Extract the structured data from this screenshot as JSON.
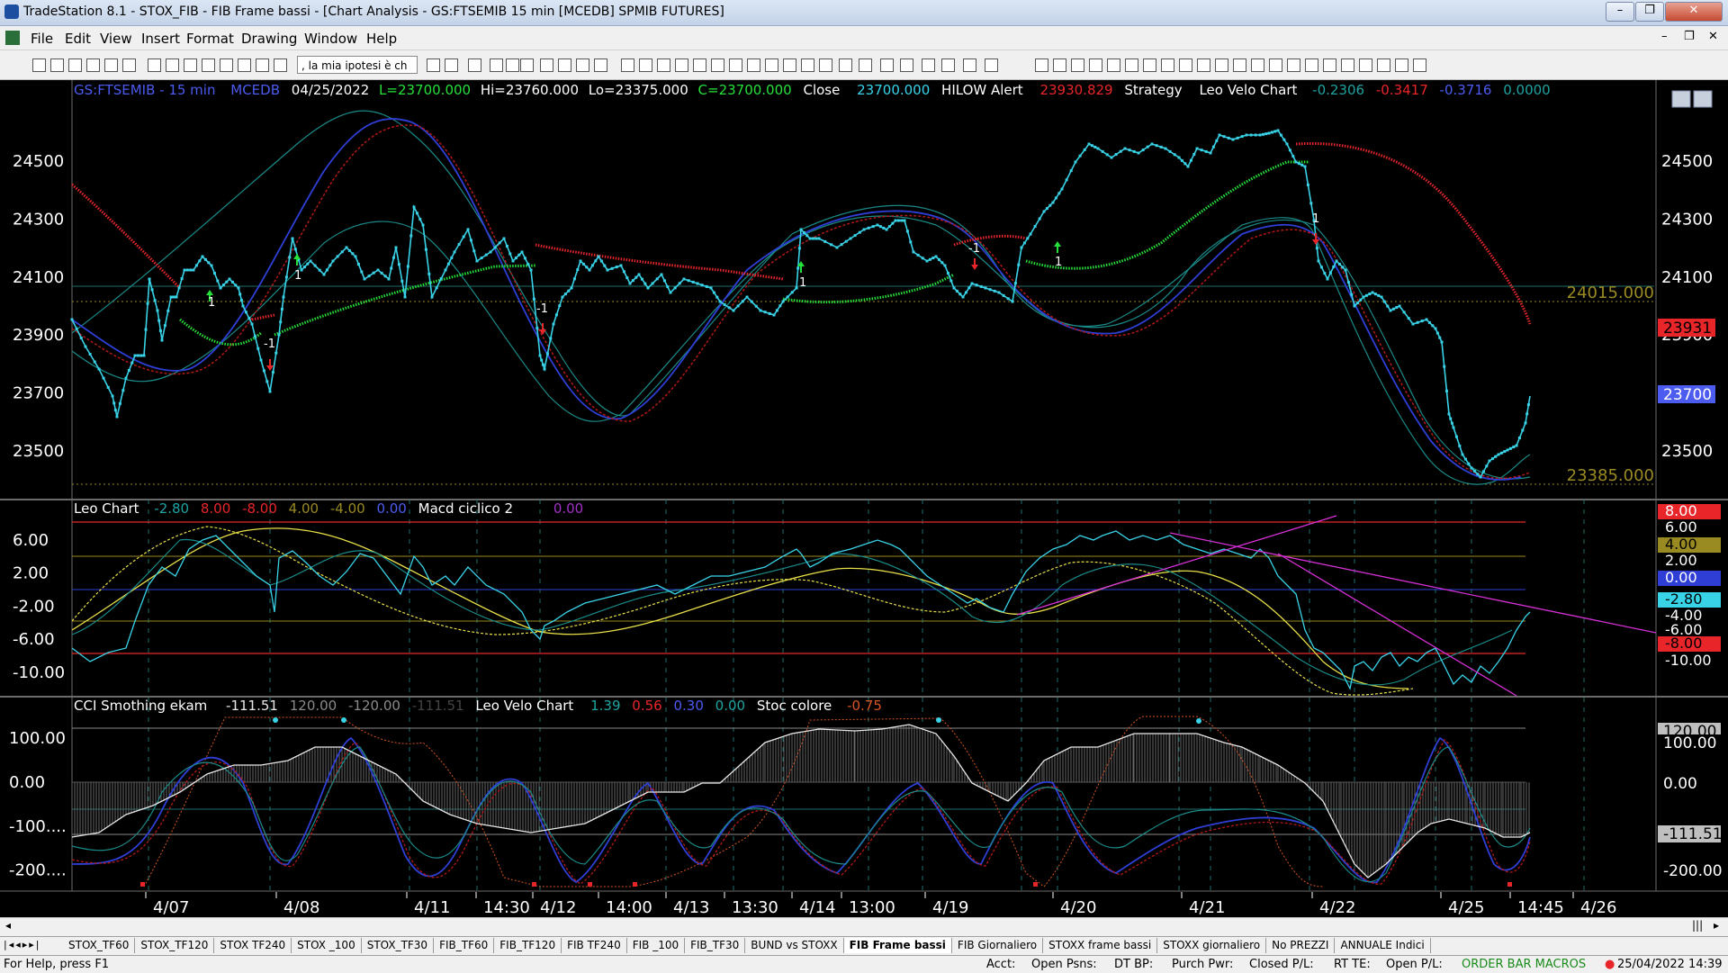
{
  "window": {
    "title": "TradeStation 8.1 - STOX_FIB - FIB Frame bassi - [Chart Analysis - GS:FTSEMIB  15 min  [MCEDB] SPMIB FUTURES]"
  },
  "menu": [
    "File",
    "Edit",
    "View",
    "Insert",
    "Format",
    "Drawing",
    "Window",
    "Help"
  ],
  "toolbar": {
    "combo_value": ", la mia ipotesi è ch"
  },
  "colors": {
    "background": "#000000",
    "price": "#39d3e8",
    "bull_stop": "#26e03a",
    "bear_stop": "#e8262a",
    "grid": "#1f6d6d",
    "blue": "#2f3fd6",
    "maroon": "#b01818",
    "teal": "#1fa3a0",
    "magenta": "#d530d5",
    "yellow": "#e8e048",
    "olive": "#9a8a22"
  },
  "panel1": {
    "symbol": "GS:FTSEMIB - 15 min",
    "source": "MCEDB",
    "date": "04/25/2022",
    "last": "L=23700.000",
    "hi": "Hi=23760.000",
    "lo": "Lo=23375.000",
    "close_val": "C=23700.000",
    "close_lbl": "Close",
    "close_num": "23700.000",
    "hilow_lbl": "HILOW Alert",
    "hilow_num": "23930.829",
    "strategy_lbl": "Strategy",
    "leovelo_lbl": "Leo Velo Chart",
    "v1": "-0.2306",
    "v2": "-0.3417",
    "v3": "-0.3716",
    "v4": "0.0000",
    "yticks": [
      "24500",
      "24300",
      "24100",
      "23900",
      "23700",
      "23500"
    ],
    "ytick_values": [
      24500,
      24300,
      24100,
      23900,
      23700,
      23500
    ],
    "level_high": "24015.000",
    "level_low": "23385.000",
    "tag_stop": "23931",
    "tag_price": "23700"
  },
  "panel2": {
    "title": "Leo Chart",
    "v1": "-2.80",
    "v2": "8.00",
    "v3": "-8.00",
    "v4": "4.00",
    "v5": "-4.00",
    "v6": "0.00",
    "title2": "Macd ciclico 2",
    "v7": "0.00",
    "yticks": [
      "6.00",
      "2.00",
      "-2.00",
      "-6.00",
      "-10.00"
    ],
    "ytick_values": [
      6,
      2,
      -2,
      -6,
      -10
    ],
    "tags": [
      "8.00",
      "6.00",
      "4.00",
      "2.00",
      "0.00",
      "-2.80",
      "-4.00",
      "-6.00",
      "-8.00",
      "-10.00"
    ]
  },
  "panel3": {
    "title": "CCI Smothing ekam",
    "v1": "-111.51",
    "v2": "120.00",
    "v3": "-120.00",
    "v4": "-111.51",
    "title2": "Leo Velo Chart",
    "v5": "1.39",
    "v6": "0.56",
    "v7": "0.30",
    "v8": "0.00",
    "title3": "Stoc colore",
    "v9": "-0.75",
    "yticks": [
      "100.00",
      "0.00",
      "-100....",
      "-200...."
    ],
    "ytick_values": [
      100,
      0,
      -100,
      -200
    ],
    "tags": [
      "120.00",
      "100.00",
      "0.00",
      "-111.51",
      "-200.00"
    ]
  },
  "xaxis": [
    "4/07",
    "4/08",
    "4/11",
    "14:30",
    "4/12",
    "14:00",
    "4/13",
    "13:30",
    "4/14",
    "13:00",
    "4/19",
    "4/20",
    "4/21",
    "4/22",
    "4/25",
    "14:45",
    "4/26"
  ],
  "tabs": [
    "STOX_TF60",
    "STOX_TF120",
    "STOX TF240",
    "STOX _100",
    "STOX_TF30",
    "FIB_TF60",
    "FIB_TF120",
    "FIB TF240",
    "FIB _100",
    "FIB_TF30",
    "BUND vs STOXX",
    "FIB Frame bassi",
    "FIB Giornaliero",
    "STOXX frame bassi",
    "STOXX giornaliero",
    "No PREZZI",
    "ANNUALE Indici"
  ],
  "active_tab": "FIB Frame bassi",
  "status": {
    "help": "For Help, press F1",
    "acct": "Acct:",
    "psns": "Open Psns:",
    "dtbp": "DT BP:",
    "purch": "Purch Pwr:",
    "closed": "Closed P/L:",
    "rtte": "RT TE:",
    "openpl": "Open P/L:",
    "macros": "ORDER BAR  MACROS",
    "datetime": "25/04/2022 14:39"
  },
  "chart_data": [
    {
      "type": "line",
      "title": "GS:FTSEMIB - 15 min",
      "x": [
        "4/07",
        "4/08",
        "4/11",
        "14:30",
        "4/12",
        "14:00",
        "4/13",
        "13:30",
        "4/14",
        "13:00",
        "4/19",
        "4/20",
        "4/21",
        "4/22",
        "4/25"
      ],
      "ylim": [
        23370,
        24640
      ],
      "series": [
        {
          "name": "Close",
          "values": [
            23760,
            24120,
            24140,
            24100,
            23780,
            24060,
            24010,
            23920,
            24180,
            24220,
            24040,
            24480,
            24560,
            24120,
            23700
          ]
        },
        {
          "name": "HILOW Alert",
          "values": [
            24420,
            23900,
            23960,
            24110,
            24200,
            24130,
            24080,
            23990,
            24080,
            24220,
            23980,
            24300,
            24450,
            24550,
            23931
          ]
        }
      ]
    },
    {
      "type": "line",
      "title": "Leo Chart",
      "x": [
        "4/07",
        "4/08",
        "4/11",
        "14:30",
        "4/12",
        "14:00",
        "4/13",
        "13:30",
        "4/14",
        "13:00",
        "4/19",
        "4/20",
        "4/21",
        "4/22",
        "4/25"
      ],
      "ylim": [
        -13,
        9
      ],
      "series": [
        {
          "name": "Leo Chart",
          "values": [
            -9,
            -1,
            2,
            0,
            -6,
            -3,
            -2,
            1,
            3,
            4,
            -4,
            6,
            5,
            -8,
            -2.8
          ]
        },
        {
          "name": "Macd ciclico 2",
          "values": [
            -7,
            5,
            2,
            -2,
            -5,
            -4,
            -2,
            0,
            1,
            2,
            -3,
            2,
            3,
            -9,
            -9
          ]
        }
      ]
    },
    {
      "type": "line",
      "title": "CCI Smothing ekam",
      "x": [
        "4/07",
        "4/08",
        "4/11",
        "14:30",
        "4/12",
        "14:00",
        "4/13",
        "13:30",
        "4/14",
        "13:00",
        "4/19",
        "4/20",
        "4/21",
        "4/22",
        "4/25"
      ],
      "ylim": [
        -245,
        160
      ],
      "series": [
        {
          "name": "CCI Smothing ekam",
          "values": [
            -150,
            90,
            60,
            -60,
            -160,
            -80,
            -30,
            40,
            100,
            80,
            -120,
            130,
            90,
            -200,
            -111.51
          ]
        },
        {
          "name": "Stoc colore",
          "values": [
            -200,
            150,
            100,
            -150,
            -220,
            -200,
            -100,
            30,
            150,
            120,
            -220,
            150,
            150,
            -230,
            -220
          ]
        }
      ]
    }
  ]
}
